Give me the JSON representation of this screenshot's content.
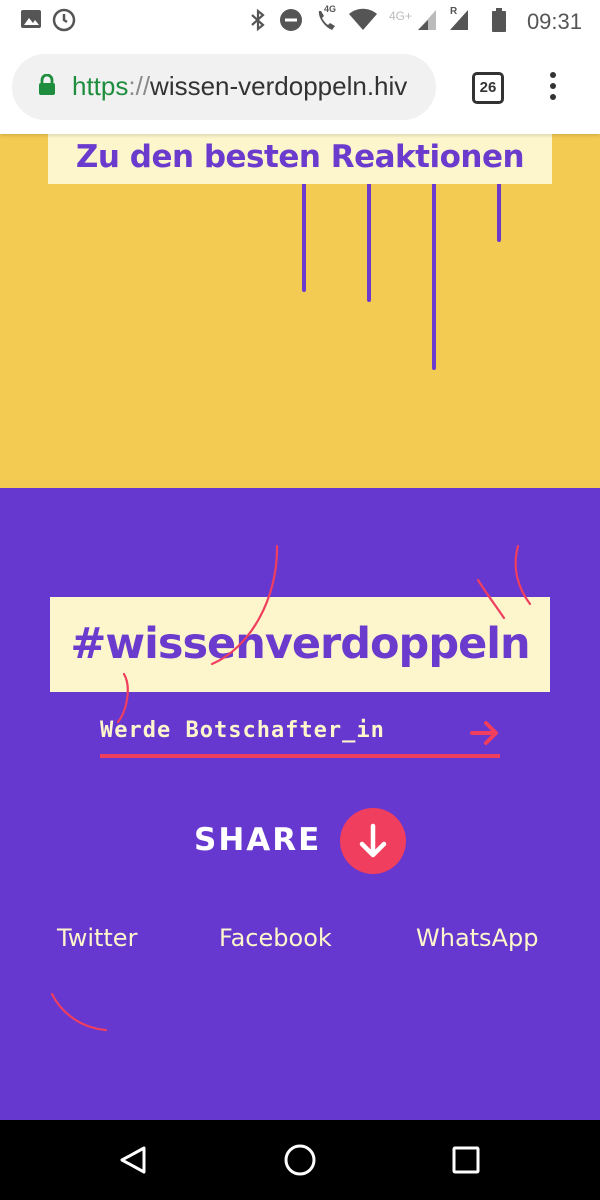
{
  "status_bar": {
    "time": "09:31",
    "network_label": "4G",
    "network_label_2": "4G+",
    "roaming_label": "R",
    "icons": [
      "image-icon",
      "clock-icon",
      "bluetooth-icon",
      "do-not-disturb-icon",
      "wifi-call-icon",
      "wifi-icon",
      "signal-icon",
      "signal-roaming-icon",
      "battery-icon"
    ]
  },
  "browser": {
    "url_scheme": "https",
    "url_separator": "://",
    "url_host": "wissen-verdoppeln.hiv",
    "tab_count": "26"
  },
  "yellow_section": {
    "best_reactions_label": "Zu den besten Reaktionen",
    "background_color": "#f3cb52",
    "accent_color": "#6a3bcd"
  },
  "purple_section": {
    "hashtag": "#wissenverdoppeln",
    "ambassador_label": "Werde Botschafter_in",
    "share_label": "SHARE",
    "social_links": [
      "Twitter",
      "Facebook",
      "WhatsApp"
    ],
    "background_color": "#6638cf",
    "highlight_color": "#f03e5e"
  },
  "nav_bar": {
    "icons": [
      "back-icon",
      "home-icon",
      "recents-icon"
    ]
  }
}
